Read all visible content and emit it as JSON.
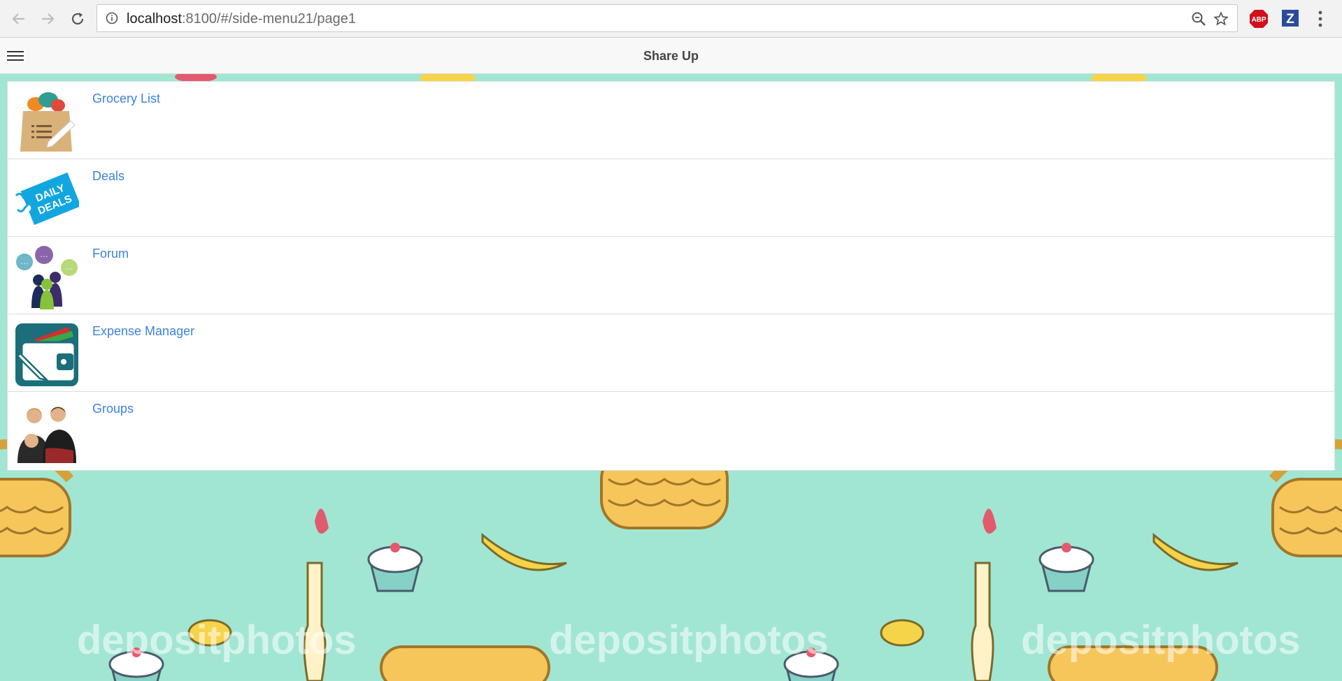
{
  "browser": {
    "url_host": "localhost",
    "url_rest": ":8100/#/side-menu21/page1",
    "extensions": [
      "ABP",
      "Z"
    ]
  },
  "app": {
    "title": "Share Up",
    "menu": [
      {
        "label": "Grocery List",
        "icon": "grocery-bag-icon"
      },
      {
        "label": "Deals",
        "icon": "daily-deals-tag-icon"
      },
      {
        "label": "Forum",
        "icon": "forum-people-icon"
      },
      {
        "label": "Expense Manager",
        "icon": "wallet-icon"
      },
      {
        "label": "Groups",
        "icon": "groups-people-icon"
      }
    ]
  },
  "thumb_text": {
    "deals_line1": "DAILY",
    "deals_line2": "DEALS"
  },
  "watermark": "depositphotos",
  "colors": {
    "link": "#3b82dd",
    "background": "#a1e6d3"
  }
}
